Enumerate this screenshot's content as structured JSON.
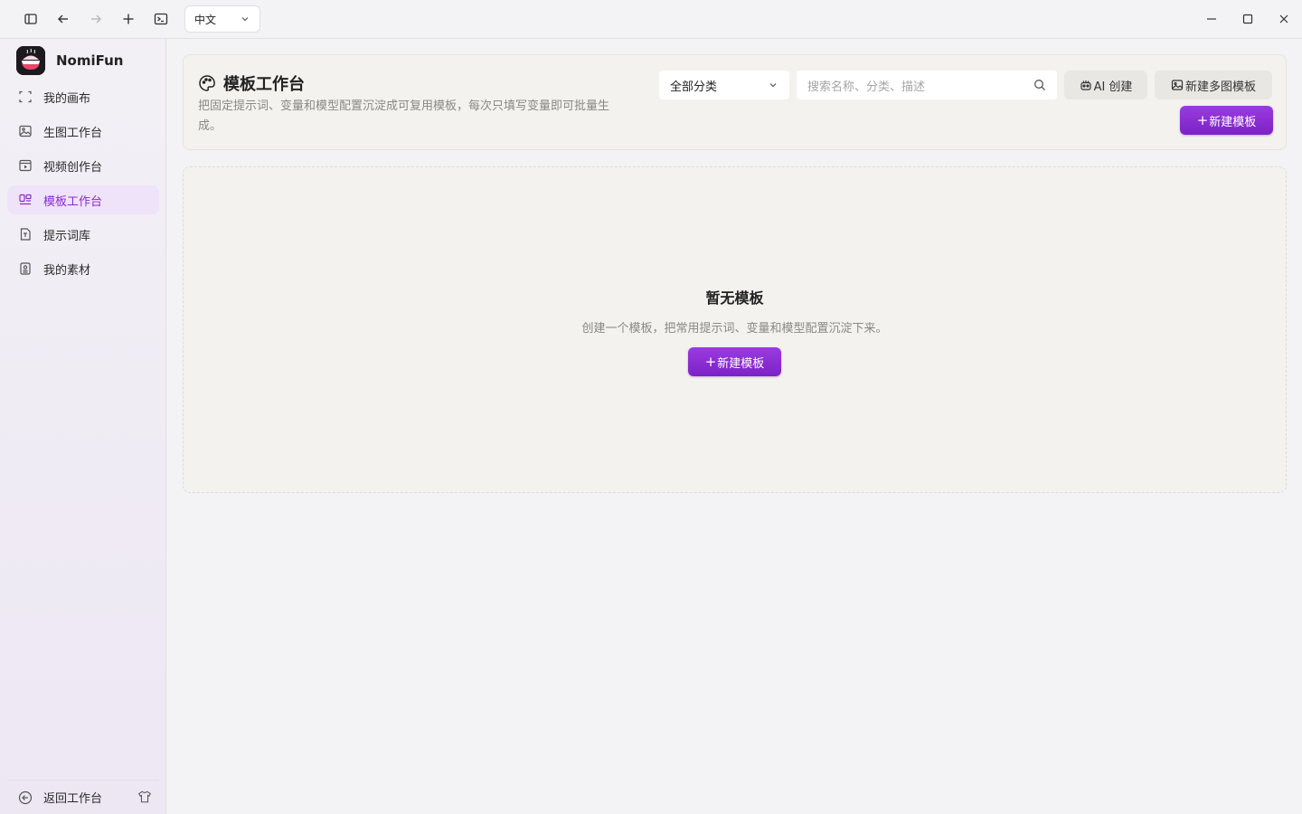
{
  "titlebar": {
    "language": "中文"
  },
  "app": {
    "name": "NomiFun"
  },
  "sidebar": {
    "items": [
      {
        "label": "我的画布",
        "icon": "canvas-icon"
      },
      {
        "label": "生图工作台",
        "icon": "image-icon"
      },
      {
        "label": "视频创作台",
        "icon": "video-icon"
      },
      {
        "label": "模板工作台",
        "icon": "template-icon",
        "active": true
      },
      {
        "label": "提示词库",
        "icon": "prompt-icon"
      },
      {
        "label": "我的素材",
        "icon": "assets-icon"
      }
    ],
    "footer_label": "返回工作台"
  },
  "header": {
    "title": "模板工作台",
    "description": "把固定提示词、变量和模型配置沉淀成可复用模板，每次只填写变量即可批量生成。",
    "category_selected": "全部分类",
    "search_placeholder": "搜索名称、分类、描述",
    "ai_create_label": "AI 创建",
    "multi_image_label": "新建多图模板",
    "new_template_label": "新建模板"
  },
  "empty": {
    "title": "暂无模板",
    "description": "创建一个模板，把常用提示词、变量和模型配置沉淀下来。",
    "button_label": "新建模板"
  },
  "colors": {
    "accent": "#8a2bd0",
    "active_bg": "#efe3fa"
  }
}
